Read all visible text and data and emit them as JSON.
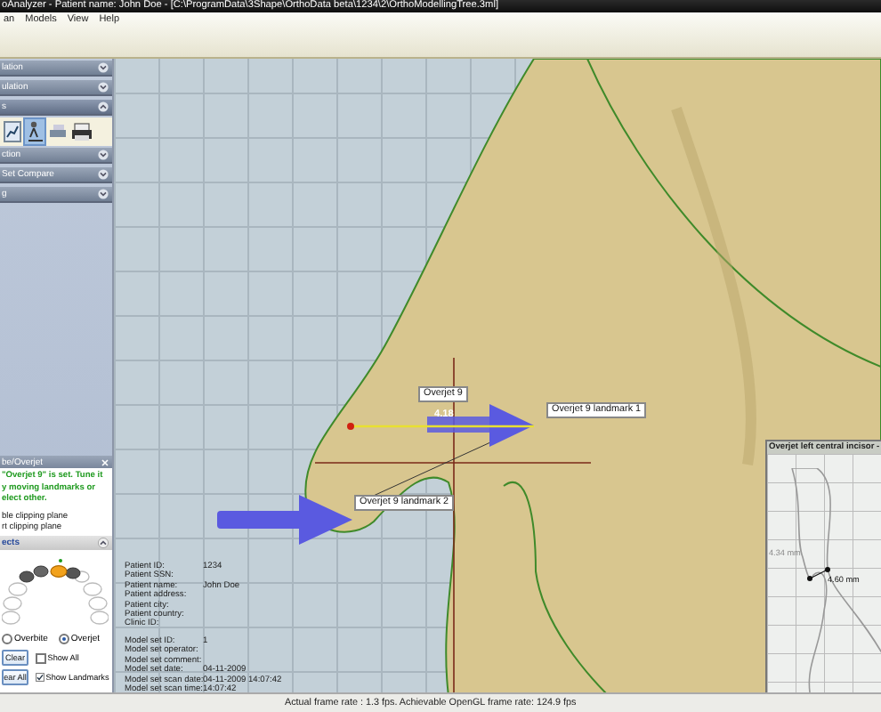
{
  "window": {
    "title": "oAnalyzer - Patient name: John Doe - [C:\\ProgramData\\3Shape\\OrthoData beta\\1234\\2\\OrthoModellingTree.3ml]"
  },
  "menu": [
    "an",
    "Models",
    "View",
    "Help"
  ],
  "sidebar": {
    "sections": [
      {
        "label": "lation",
        "expanded": false
      },
      {
        "label": "ulation",
        "expanded": false
      },
      {
        "label": "s",
        "expanded": true
      },
      {
        "label": "ction",
        "expanded": false
      },
      {
        "label": "Set Compare",
        "expanded": false
      },
      {
        "label": "g",
        "expanded": false
      }
    ]
  },
  "overjet_panel": {
    "title": "be/Overjet",
    "message_lines": [
      "\"Overjet 9\" is set.  Tune it",
      "y moving landmarks or",
      "elect other."
    ],
    "clipping_options": [
      "ble clipping plane",
      "rt clipping plane"
    ],
    "objects_header": "ects",
    "mode_options": [
      {
        "label": "Overbite",
        "selected": false
      },
      {
        "label": "Overjet",
        "selected": true
      }
    ],
    "buttons": [
      "Clear",
      "ear All"
    ],
    "checkboxes": [
      {
        "label": "Show All",
        "checked": false
      },
      {
        "label": "Show Landmarks",
        "checked": true
      }
    ]
  },
  "viewport": {
    "measurement": "4.18",
    "labels": [
      "Overjet 9",
      "Overjet 9 landmark 1",
      "Overjet 9 landmark 2"
    ],
    "patient_info": [
      {
        "label": "Patient ID:",
        "value": "1234"
      },
      {
        "label": "Patient SSN:"
      },
      {
        "label": "Patient name:",
        "value": "John Doe"
      },
      {
        "label": "Patient address:"
      },
      {
        "label": "Patient city:"
      },
      {
        "label": "Patient country:"
      },
      {
        "label": "Clinic ID:"
      }
    ],
    "model_info": [
      {
        "label": "Model set ID:",
        "value": "1"
      },
      {
        "label": "Model set operator:"
      },
      {
        "label": "Model set comment:"
      },
      {
        "label": "Model set date:",
        "value": "04-11-2009"
      },
      {
        "label": "Model set scan date:",
        "value": "04-11-2009 14:07:42"
      },
      {
        "label": "Model set scan time:",
        "value": "14:07:42"
      }
    ],
    "inset": {
      "title": "Overjet left central incisor -",
      "readings": [
        "4.34 mm",
        "4.60 mm"
      ]
    }
  },
  "status_bar": "Actual frame rate : 1.3 fps. Achievable OpenGL frame rate: 124.9 fps"
}
